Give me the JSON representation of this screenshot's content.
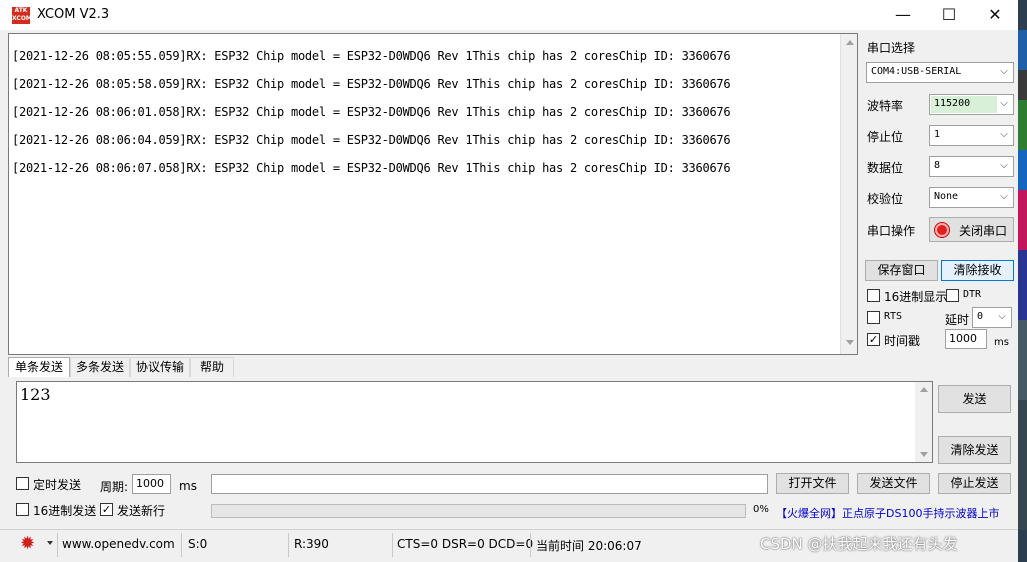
{
  "window": {
    "title": "XCOM V2.3",
    "logo_text": "ATK XCOM",
    "minimize": "—",
    "maximize": "☐",
    "close": "✕"
  },
  "receive": {
    "lines": [
      "[2021-12-26 08:05:55.059]RX: ESP32 Chip model = ESP32-D0WDQ6 Rev 1This chip has 2 coresChip ID: 3360676",
      "[2021-12-26 08:05:58.059]RX: ESP32 Chip model = ESP32-D0WDQ6 Rev 1This chip has 2 coresChip ID: 3360676",
      "[2021-12-26 08:06:01.058]RX: ESP32 Chip model = ESP32-D0WDQ6 Rev 1This chip has 2 coresChip ID: 3360676",
      "[2021-12-26 08:06:04.059]RX: ESP32 Chip model = ESP32-D0WDQ6 Rev 1This chip has 2 coresChip ID: 3360676",
      "[2021-12-26 08:06:07.058]RX: ESP32 Chip model = ESP32-D0WDQ6 Rev 1This chip has 2 coresChip ID: 3360676"
    ]
  },
  "settings": {
    "port_label": "串口选择",
    "port_value": "COM4:USB-SERIAL",
    "baud_label": "波特率",
    "baud_value": "115200",
    "stop_label": "停止位",
    "stop_value": "1",
    "data_label": "数据位",
    "data_value": "8",
    "parity_label": "校验位",
    "parity_value": "None",
    "op_label": "串口操作",
    "close_port": "关闭串口",
    "save_window": "保存窗口",
    "clear_recv": "清除接收",
    "hex_display": "16进制显示",
    "dtr": "DTR",
    "rts": "RTS",
    "delay_label": "延时",
    "delay_value": "0",
    "timestamp": "时间戳",
    "timestamp_value": "1000",
    "ms": "ms"
  },
  "tabs": [
    "单条发送",
    "多条发送",
    "协议传输",
    "帮助"
  ],
  "send": {
    "text": "123",
    "send_btn": "发送",
    "clear_send": "清除发送",
    "timed_send": "定时发送",
    "period_label": "周期:",
    "period_value": "1000",
    "ms": "ms",
    "hex_send": "16进制发送",
    "send_newline": "发送新行",
    "open_file": "打开文件",
    "send_file": "发送文件",
    "stop_send": "停止发送",
    "progress_text": "0%",
    "promo": "【火爆全网】正点原子DS100手持示波器上市"
  },
  "status": {
    "url": "www.openedv.com",
    "sent": "S:0",
    "recv": "R:390",
    "lines": "CTS=0 DSR=0 DCD=0",
    "time": "当前时间 20:06:07",
    "watermark": "CSDN @扶我起来我还有头发"
  }
}
